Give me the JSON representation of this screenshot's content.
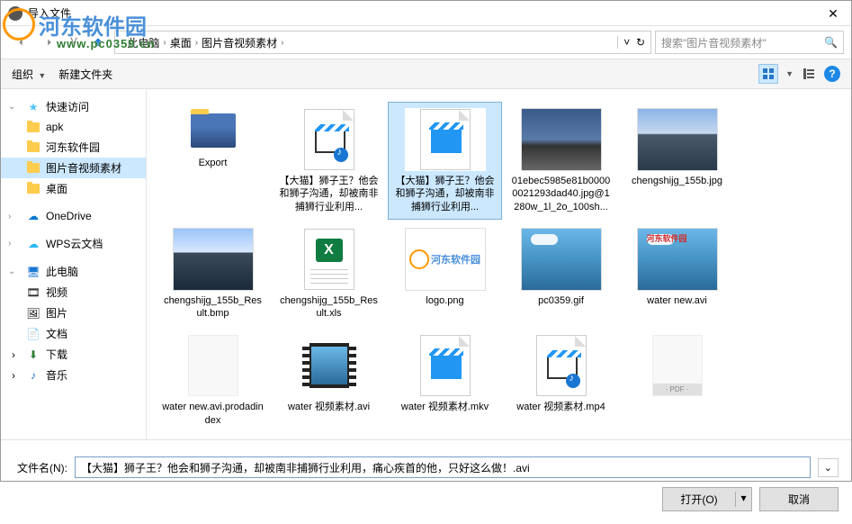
{
  "title": "导入文件",
  "watermark": {
    "text": "河东软件园",
    "url": "www.pc0359.cn"
  },
  "breadcrumb": {
    "pc": "此电脑",
    "desktop": "桌面",
    "folder": "图片音视频素材"
  },
  "search_placeholder": "搜索\"图片音视频素材\"",
  "toolbar": {
    "organize": "组织",
    "newfolder": "新建文件夹"
  },
  "sidebar": {
    "quick": {
      "label": "快速访问",
      "items": [
        "apk",
        "河东软件园",
        "图片音视频素材",
        "桌面"
      ]
    },
    "onedrive": "OneDrive",
    "wps": "WPS云文档",
    "thispc": {
      "label": "此电脑",
      "items": [
        "视频",
        "图片",
        "文档",
        "下载",
        "音乐"
      ]
    }
  },
  "files": [
    {
      "name": "Export",
      "type": "folder-img"
    },
    {
      "name": "【大猫】狮子王？他会和狮子沟通，却被南非捕狮行业利用...",
      "type": "video-music"
    },
    {
      "name": "【大猫】狮子王？他会和狮子沟通，却被南非捕狮行业利用...",
      "type": "video-doc",
      "selected": true
    },
    {
      "name": "01ebec5985e81b00000021293dad40.jpg@1280w_1l_2o_100sh...",
      "type": "image-sky"
    },
    {
      "name": "chengshijg_155b.jpg",
      "type": "image-bld"
    },
    {
      "name": "chengshijg_155b_Result.bmp",
      "type": "image-bld-pix"
    },
    {
      "name": "chengshijg_155b_Result.xls",
      "type": "xls"
    },
    {
      "name": "logo.png",
      "type": "logo"
    },
    {
      "name": "pc0359.gif",
      "type": "ocean"
    },
    {
      "name": "water  new.avi",
      "type": "ocean-wm"
    },
    {
      "name": "water new.avi.prodadindex",
      "type": "blank"
    },
    {
      "name": "water 视频素材.avi",
      "type": "film"
    },
    {
      "name": "water 视频素材.mkv",
      "type": "video-doc2"
    },
    {
      "name": "water 视频素材.mp4",
      "type": "video-music"
    },
    {
      "name": "",
      "type": "blank-pdf"
    },
    {
      "name": "",
      "type": "film-dark"
    },
    {
      "name": "",
      "type": "blank-pdf"
    }
  ],
  "footer": {
    "filename_label": "文件名(N):",
    "filename_value": "【大猫】狮子王？他会和狮子沟通，却被南非捕狮行业利用，痛心疾首的他，只好这么做！.avi",
    "open": "打开(O)",
    "cancel": "取消"
  }
}
